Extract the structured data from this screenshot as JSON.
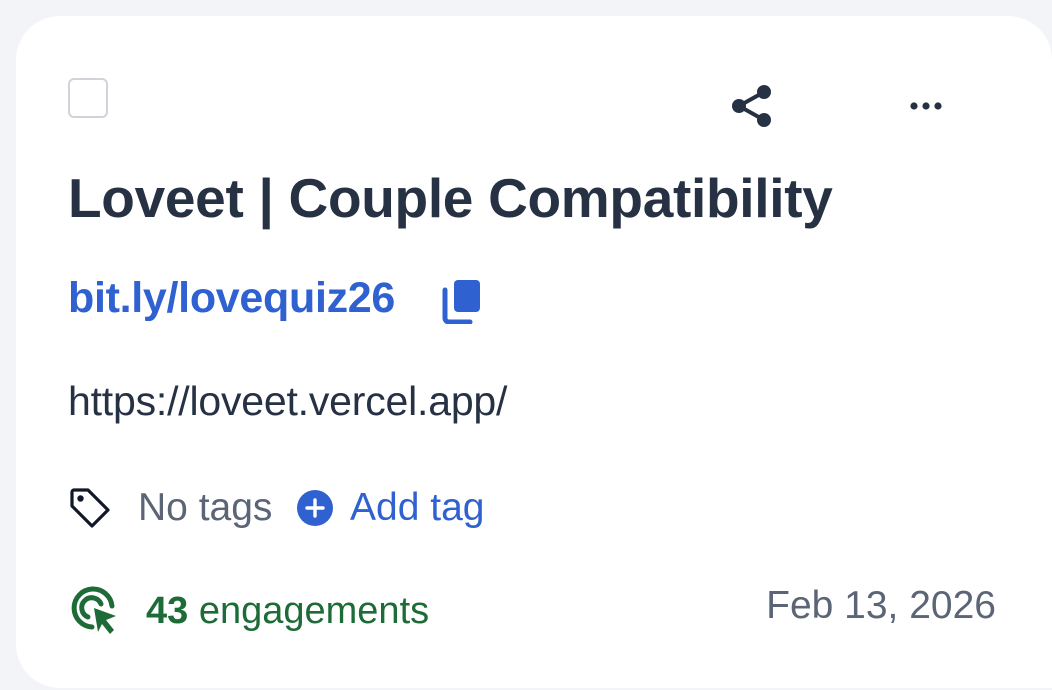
{
  "card": {
    "title": "Loveet | Couple Compatibility",
    "short_link": "bit.ly/lovequiz26",
    "long_url": "https://loveet.vercel.app/",
    "tags": {
      "empty_label": "No tags",
      "add_label": "Add tag"
    },
    "engagements": {
      "count": "43",
      "label": "engagements"
    },
    "date": "Feb 13, 2026"
  },
  "colors": {
    "title": "#273144",
    "link": "#2f61d0",
    "muted": "#5b6576",
    "engagement": "#1d6b36",
    "background": "#f3f4f8",
    "card": "#ffffff"
  },
  "icons": [
    "checkbox",
    "share-icon",
    "more-horizontal-icon",
    "copy-icon",
    "tag-icon",
    "add-circle-icon",
    "engagement-cursor-icon"
  ]
}
